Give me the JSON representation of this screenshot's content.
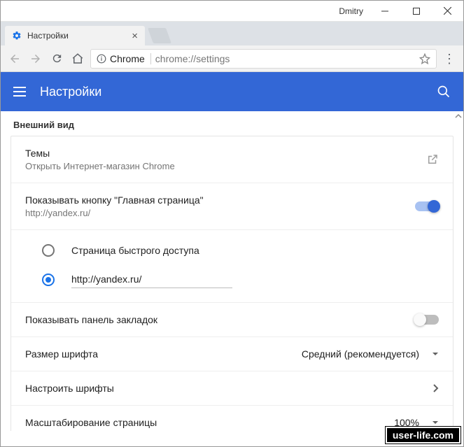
{
  "window": {
    "user": "Dmitry"
  },
  "tab": {
    "title": "Настройки"
  },
  "address": {
    "origin": "Chrome",
    "url": "chrome://settings"
  },
  "header": {
    "title": "Настройки"
  },
  "section": {
    "title": "Внешний вид"
  },
  "themes": {
    "title": "Темы",
    "subtitle": "Открыть Интернет-магазин Chrome"
  },
  "homeButton": {
    "title": "Показывать кнопку \"Главная страница\"",
    "subtitle": "http://yandex.ru/",
    "enabled": true,
    "options": {
      "quickAccess": "Страница быстрого доступа",
      "customUrl": "http://yandex.ru/",
      "selected": "customUrl"
    }
  },
  "bookmarksBar": {
    "title": "Показывать панель закладок",
    "enabled": false
  },
  "fontSize": {
    "title": "Размер шрифта",
    "value": "Средний (рекомендуется)"
  },
  "customizeFonts": {
    "title": "Настроить шрифты"
  },
  "pageZoom": {
    "title": "Масштабирование страницы",
    "value": "100%"
  },
  "watermark": "user-life.com"
}
